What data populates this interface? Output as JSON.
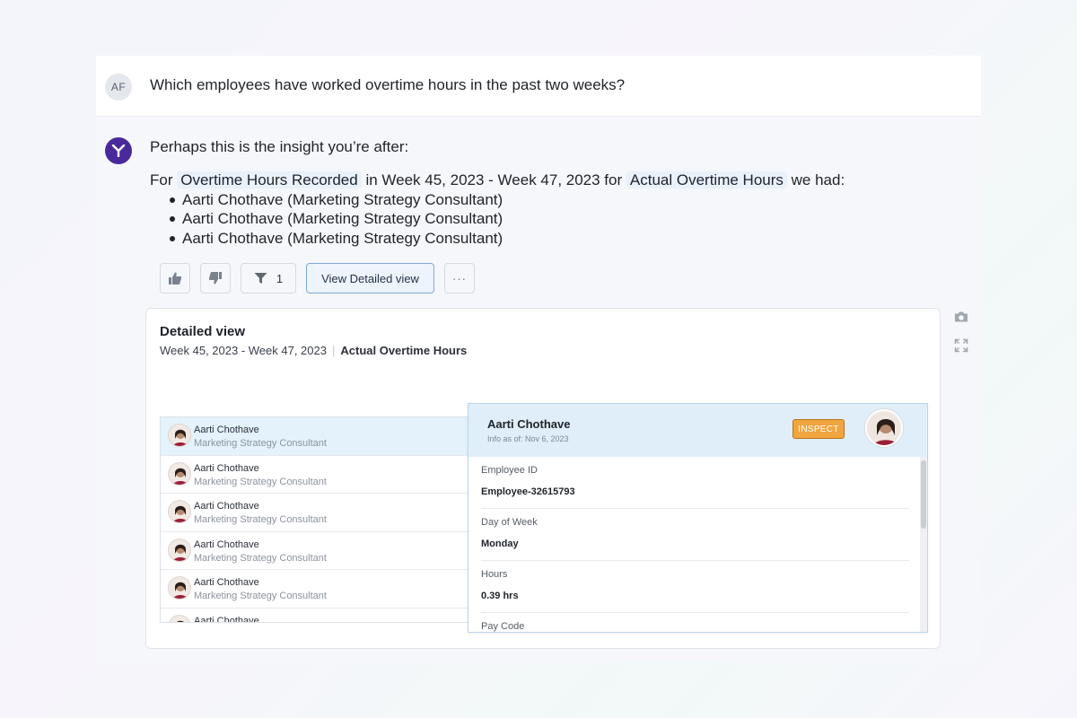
{
  "user_message": {
    "avatar_initials": "AF",
    "text": "Which employees have worked overtime hours in the past two weeks?"
  },
  "bot_message": {
    "intro": "Perhaps this is the insight you’re after:",
    "answer_prefix": "For",
    "measure_chip": "Overtime Hours Recorded",
    "answer_mid": "in Week 45, 2023 - Week 47, 2023 for",
    "metric_chip": "Actual Overtime Hours",
    "answer_suffix": "we had:",
    "results": [
      "Aarti Chothave (Marketing Strategy Consultant)",
      "Aarti Chothave (Marketing Strategy Consultant)",
      "Aarti Chothave (Marketing Strategy Consultant)"
    ]
  },
  "actions": {
    "filter_count": "1",
    "view_detail_label": "View Detailed view",
    "more_label": "···"
  },
  "detailed_view": {
    "title": "Detailed view",
    "date_range": "Week 45, 2023 - Week 47, 2023",
    "metric": "Actual Overtime Hours",
    "employees": [
      {
        "name": "Aarti Chothave",
        "role": "Marketing Strategy Consultant"
      },
      {
        "name": "Aarti Chothave",
        "role": "Marketing Strategy Consultant"
      },
      {
        "name": "Aarti Chothave",
        "role": "Marketing Strategy Consultant"
      },
      {
        "name": "Aarti Chothave",
        "role": "Marketing Strategy Consultant"
      },
      {
        "name": "Aarti Chothave",
        "role": "Marketing Strategy Consultant"
      },
      {
        "name": "Aarti Chothave",
        "role": ""
      }
    ],
    "employee_detail": {
      "name": "Aarti Chothave",
      "info_as_of": "Info as of: Nov 6, 2023",
      "inspect_label": "INSPECT",
      "fields": [
        {
          "label": "Employee ID",
          "value": "Employee-32615793"
        },
        {
          "label": "Day of Week",
          "value": "Monday"
        },
        {
          "label": "Hours",
          "value": "0.39 hrs"
        },
        {
          "label": "Pay Code",
          "value": ""
        }
      ]
    }
  },
  "icons": {
    "thumbs_up": "thumbs-up-icon",
    "thumbs_down": "thumbs-down-icon",
    "filter": "filter-icon",
    "camera": "camera-icon",
    "expand": "expand-icon"
  },
  "colors": {
    "bot_avatar": "#4a2a9a",
    "chip_bg": "#e9f1fb",
    "selected_row": "#e3f2fb",
    "inspect": "#f0a53e",
    "primary_border": "#7fa8d9"
  }
}
